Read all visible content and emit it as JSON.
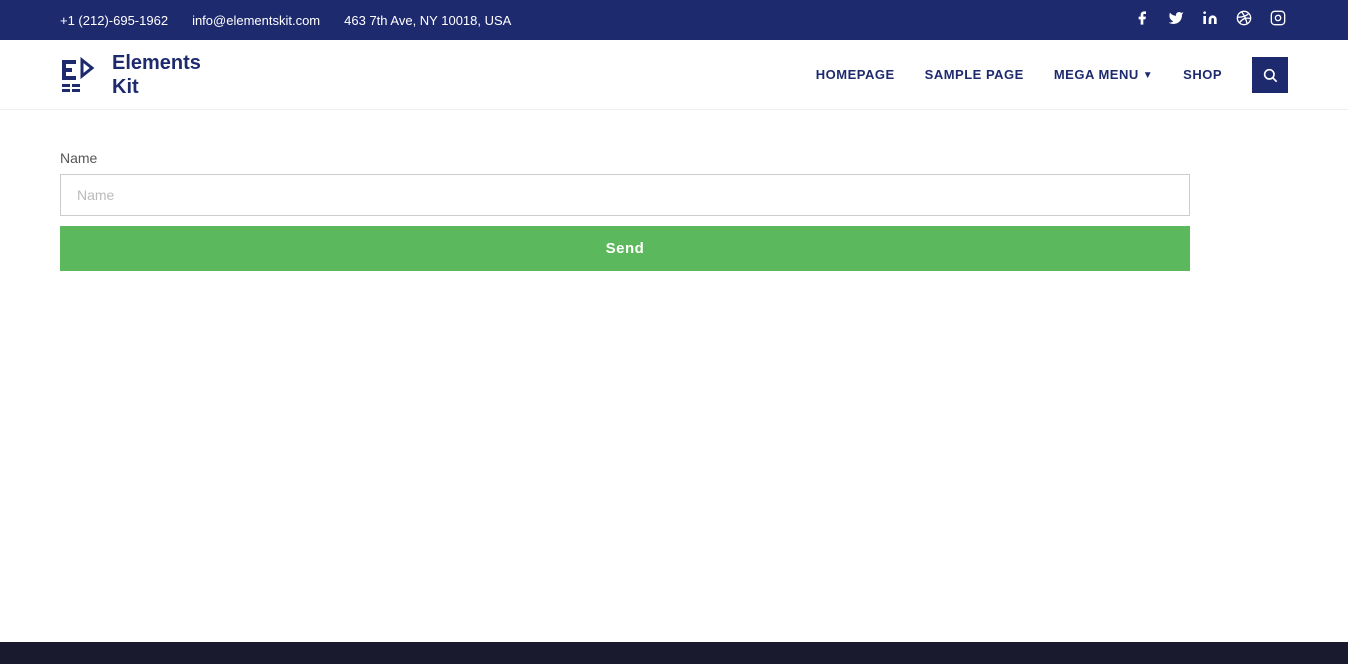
{
  "topbar": {
    "phone": "+1 (212)-695-1962",
    "email": "info@elementskit.com",
    "address": "463 7th Ave, NY 10018, USA"
  },
  "social": {
    "facebook": "f",
    "twitter": "t",
    "linkedin": "in",
    "dribbble": "⊙",
    "instagram": "□"
  },
  "logo": {
    "text_line1": "Elements",
    "text_line2": "Kit"
  },
  "nav": {
    "homepage": "HOMEPAGE",
    "sample_page": "SAMPLE PAGE",
    "mega_menu": "MEGA MENU",
    "shop": "SHOP"
  },
  "form": {
    "name_label": "Name",
    "name_placeholder": "Name",
    "send_label": "Send"
  }
}
